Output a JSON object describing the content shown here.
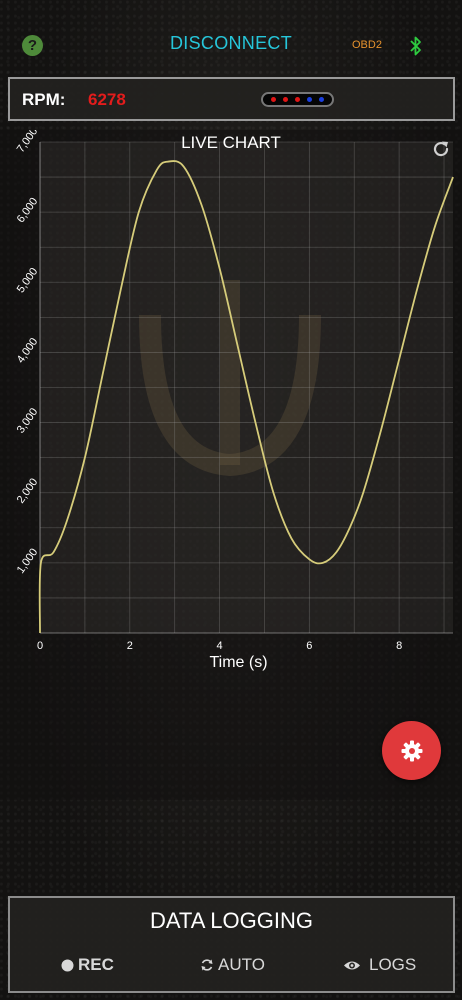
{
  "header": {
    "help_glyph": "?",
    "disconnect_label": "DISCONNECT",
    "obd_label": "OBD2",
    "bluetooth_icon": "bluetooth-icon"
  },
  "rpm": {
    "label": "RPM:",
    "value": "6278",
    "shift_lights": [
      "#e01515",
      "#e01515",
      "#e01515",
      "#1a3fe0",
      "#1a3fe0"
    ]
  },
  "chart": {
    "title": "LIVE CHART",
    "refresh_icon": "refresh-icon"
  },
  "chart_data": {
    "type": "line",
    "title": "LIVE CHART",
    "xlabel": "Time (s)",
    "ylabel": "",
    "xlim": [
      0,
      9.2
    ],
    "ylim": [
      0,
      7000
    ],
    "x_ticks": [
      0,
      2,
      4,
      6,
      8
    ],
    "y_ticks": [
      1000,
      2000,
      3000,
      4000,
      5000,
      6000,
      7000
    ],
    "x_tick_labels": [
      "0",
      "2",
      "4",
      "6",
      "8"
    ],
    "y_tick_labels": [
      "1,000",
      "2,000",
      "3,000",
      "4,000",
      "5,000",
      "6,000",
      "7,000"
    ],
    "grid": true,
    "line_color": "#d6cc7a",
    "series": [
      {
        "x": [
          0,
          0.02,
          0.3,
          0.6,
          1.0,
          1.4,
          1.8,
          2.2,
          2.6,
          2.85,
          3.2,
          3.6,
          4.0,
          4.4,
          4.8,
          5.2,
          5.6,
          6.0,
          6.3,
          6.6,
          6.9,
          7.2,
          7.6,
          8.0,
          8.4,
          8.8,
          9.2
        ],
        "y": [
          0,
          1000,
          1150,
          1600,
          2500,
          3700,
          4900,
          6000,
          6600,
          6720,
          6650,
          6100,
          5200,
          4100,
          3000,
          2000,
          1350,
          1050,
          1000,
          1150,
          1500,
          2000,
          2900,
          3900,
          4900,
          5800,
          6500
        ]
      }
    ]
  },
  "settings_fab": {
    "icon": "gear-icon",
    "color": "#e0393b"
  },
  "logging": {
    "title": "DATA LOGGING",
    "rec_label": "REC",
    "auto_label": "AUTO",
    "logs_label": "LOGS"
  }
}
